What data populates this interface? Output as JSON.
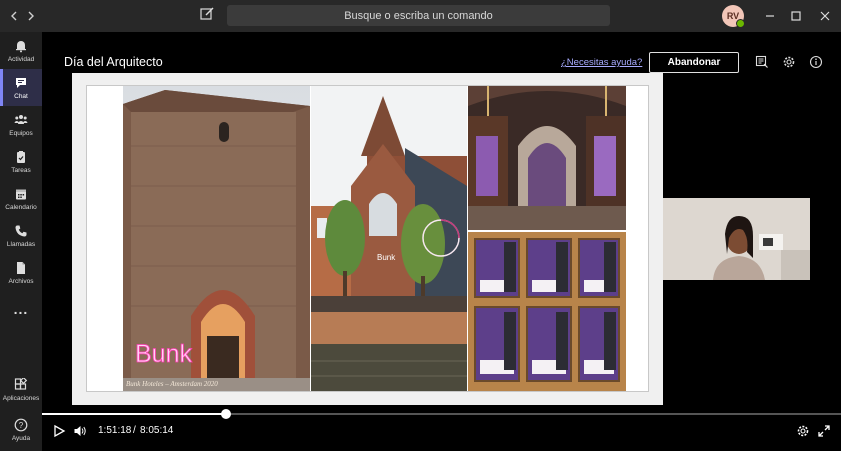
{
  "titlebar": {
    "search_placeholder": "Busque o escriba un comando",
    "avatar_initials": "RV"
  },
  "rail": {
    "items": [
      {
        "label": "Actividad",
        "icon": "bell-icon"
      },
      {
        "label": "Chat",
        "icon": "chat-icon",
        "active": true
      },
      {
        "label": "Equipos",
        "icon": "teams-icon"
      },
      {
        "label": "Tareas",
        "icon": "tasks-icon"
      },
      {
        "label": "Calendario",
        "icon": "calendar-icon"
      },
      {
        "label": "Llamadas",
        "icon": "phone-icon"
      },
      {
        "label": "Archivos",
        "icon": "file-icon"
      },
      {
        "label": "...",
        "icon": "more-icon"
      },
      {
        "label": "Aplicaciones",
        "icon": "apps-icon"
      },
      {
        "label": "Ayuda",
        "icon": "help-icon"
      }
    ]
  },
  "meeting": {
    "title": "Día del Arquitecto",
    "help_link": "¿Necesitas ayuda?",
    "leave_label": "Abandonar"
  },
  "slide": {
    "neon_sign": "Bunk",
    "caption": "Bunk Hoteles – Amsterdam 2020",
    "facade_sign": "Bunk"
  },
  "player": {
    "current_time": "1:51:18",
    "separator": "/",
    "total_time": "8:05:14",
    "progress_fraction": 0.23
  },
  "colors": {
    "accent": "#7f85f5",
    "titlebar": "#282828",
    "rail": "#1f1f1f",
    "presence": "#6bb700"
  }
}
